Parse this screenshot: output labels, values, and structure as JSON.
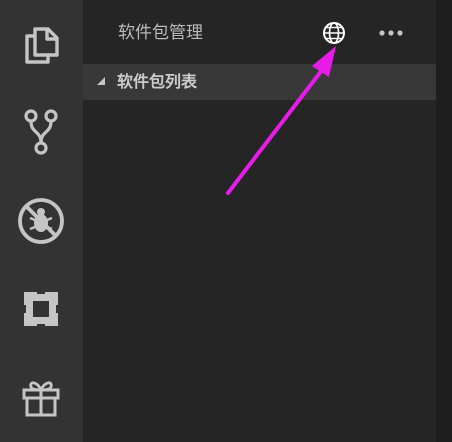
{
  "activity_bar": {
    "items": [
      {
        "icon": "explorer-files-icon"
      },
      {
        "icon": "source-control-icon"
      },
      {
        "icon": "debug-icon"
      },
      {
        "icon": "extensions-icon"
      },
      {
        "icon": "gift-icon"
      }
    ]
  },
  "sidebar": {
    "title": "软件包管理",
    "actions": {
      "globe_icon": "globe-icon",
      "more_icon": "more-actions-icon"
    },
    "section": {
      "label": "软件包列表",
      "expanded": true
    }
  },
  "annotation": {
    "arrow_color": "#e81ce8"
  },
  "colors": {
    "activity_bar_bg": "#333333",
    "sidebar_bg": "#252526",
    "section_header_bg": "#383838",
    "icon_color": "#cccccc"
  }
}
